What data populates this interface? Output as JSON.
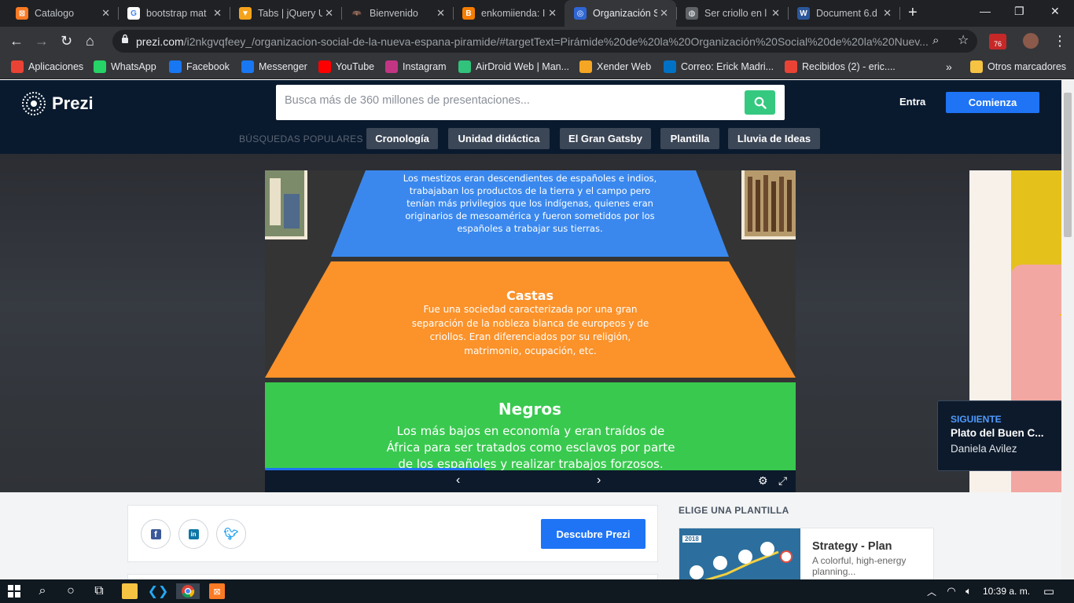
{
  "browser": {
    "tabs": [
      {
        "title": "Catalogo",
        "icon": "xampp-icon",
        "color": "#fb7a24",
        "glyph": "⊠"
      },
      {
        "title": "bootstrap mat",
        "icon": "google-icon",
        "color": "#ffffff",
        "glyph": "G"
      },
      {
        "title": "Tabs | jQuery U",
        "icon": "jquery-ui-icon",
        "color": "#f6a31c",
        "glyph": "▼"
      },
      {
        "title": "Bienvenido",
        "icon": "batman-icon",
        "color": "#202124",
        "glyph": "🦇"
      },
      {
        "title": "enkomiienda: I",
        "icon": "blogger-icon",
        "color": "#f57d00",
        "glyph": "B"
      },
      {
        "title": "Organización S",
        "icon": "prezi-icon",
        "color": "#2f66d4",
        "glyph": "◎"
      },
      {
        "title": "Ser criollo en l",
        "icon": "globe-icon",
        "color": "#5f6368",
        "glyph": "◍"
      },
      {
        "title": "Document 6.d",
        "icon": "word-icon",
        "color": "#2b579a",
        "glyph": "W"
      }
    ],
    "active_tab": 5,
    "url_host": "prezi.com",
    "url_rest": "/i2nkgvqfeey_/organizacion-social-de-la-nueva-espana-piramide/#targetText=Pirámide%20de%20la%20Organización%20Social%20de%20la%20Nuev...",
    "extension_badge": "76",
    "bookmarks": [
      {
        "label": "Aplicaciones",
        "icon": "apps-grid-icon",
        "color": "#ea4335"
      },
      {
        "label": "WhatsApp",
        "icon": "whatsapp-icon",
        "color": "#25d366"
      },
      {
        "label": "Facebook",
        "icon": "facebook-icon",
        "color": "#1877f2"
      },
      {
        "label": "Messenger",
        "icon": "facebook-icon",
        "color": "#1877f2"
      },
      {
        "label": "YouTube",
        "icon": "youtube-icon",
        "color": "#ff0000"
      },
      {
        "label": "Instagram",
        "icon": "instagram-icon",
        "color": "#c13584"
      },
      {
        "label": "AirDroid Web | Man...",
        "icon": "airdroid-icon",
        "color": "#31c27c"
      },
      {
        "label": "Xender Web",
        "icon": "xender-icon",
        "color": "#f5a623"
      },
      {
        "label": "Correo: Erick Madri...",
        "icon": "outlook-icon",
        "color": "#0072c6"
      },
      {
        "label": "Recibidos (2) - eric....",
        "icon": "gmail-icon",
        "color": "#ea4335"
      }
    ],
    "bookmarks_overflow": "»",
    "other_bookmarks": "Otros marcadores"
  },
  "prezi": {
    "logo_text": "Prezi",
    "search_placeholder": "Busca más de 360 millones de presentaciones...",
    "login": "Entra",
    "signup": "Comienza",
    "popular_label": "BÚSQUEDAS POPULARES",
    "popular": [
      "Cronología",
      "Unidad didáctica",
      "El Gran Gatsby",
      "Plantilla",
      "Lluvia de Ideas"
    ]
  },
  "slide": {
    "top_text": "Los mestizos eran descendientes de españoles e indios, trabajaban los productos de la tierra y el campo pero tenían más privilegios que los indígenas, quienes eran originarios de mesoamérica y fueron sometidos por los españoles a trabajar sus tierras.",
    "mid_title": "Castas",
    "mid_text": "Fue una sociedad caracterizada por una gran separación de la nobleza blanca de europeos y de criollos. Eran diferenciados por su religión, matrimonio, ocupación, etc.",
    "bottom_title": "Negros",
    "bottom_text": "Los más bajos en economía y eran traídos  de África para ser tratados como esclavos por parte de los españoles y realizar trabajos forzosos.",
    "colors": {
      "top": "#3a88ee",
      "mid": "#fb922a",
      "bottom": "#39c94f"
    }
  },
  "next": {
    "label": "SIGUIENTE",
    "title": "Plato del Buen C...",
    "author": "Daniela Avilez"
  },
  "share": {
    "discover": "Descubre Prezi"
  },
  "templates": {
    "heading": "ELIGE UNA PLANTILLA",
    "card_title": "Strategy - Plan",
    "card_desc": "A colorful, high-energy planning...",
    "thumb_year": "2018"
  },
  "taskbar": {
    "time": "10:39 a. m."
  }
}
